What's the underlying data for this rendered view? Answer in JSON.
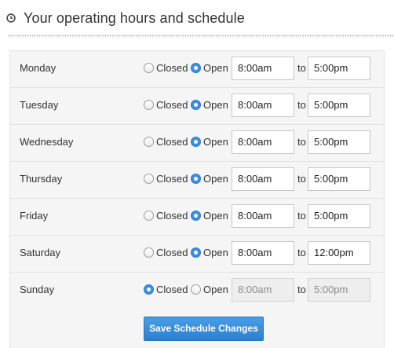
{
  "header": {
    "title": "Your operating hours and schedule",
    "icon": "clock-icon"
  },
  "labels": {
    "closed": "Closed",
    "open": "Open",
    "to": "to"
  },
  "schedule": [
    {
      "day": "Monday",
      "status": "open",
      "from": "8:00am",
      "to": "5:00pm"
    },
    {
      "day": "Tuesday",
      "status": "open",
      "from": "8:00am",
      "to": "5:00pm"
    },
    {
      "day": "Wednesday",
      "status": "open",
      "from": "8:00am",
      "to": "5:00pm"
    },
    {
      "day": "Thursday",
      "status": "open",
      "from": "8:00am",
      "to": "5:00pm"
    },
    {
      "day": "Friday",
      "status": "open",
      "from": "8:00am",
      "to": "5:00pm"
    },
    {
      "day": "Saturday",
      "status": "open",
      "from": "8:00am",
      "to": "12:00pm"
    },
    {
      "day": "Sunday",
      "status": "closed",
      "from": "8:00am",
      "to": "5:00pm"
    }
  ],
  "save_button": "Save Schedule Changes",
  "colors": {
    "accent": "#3b8ee3",
    "button": "#3a8ddb",
    "panel": "#f5f5f5"
  }
}
